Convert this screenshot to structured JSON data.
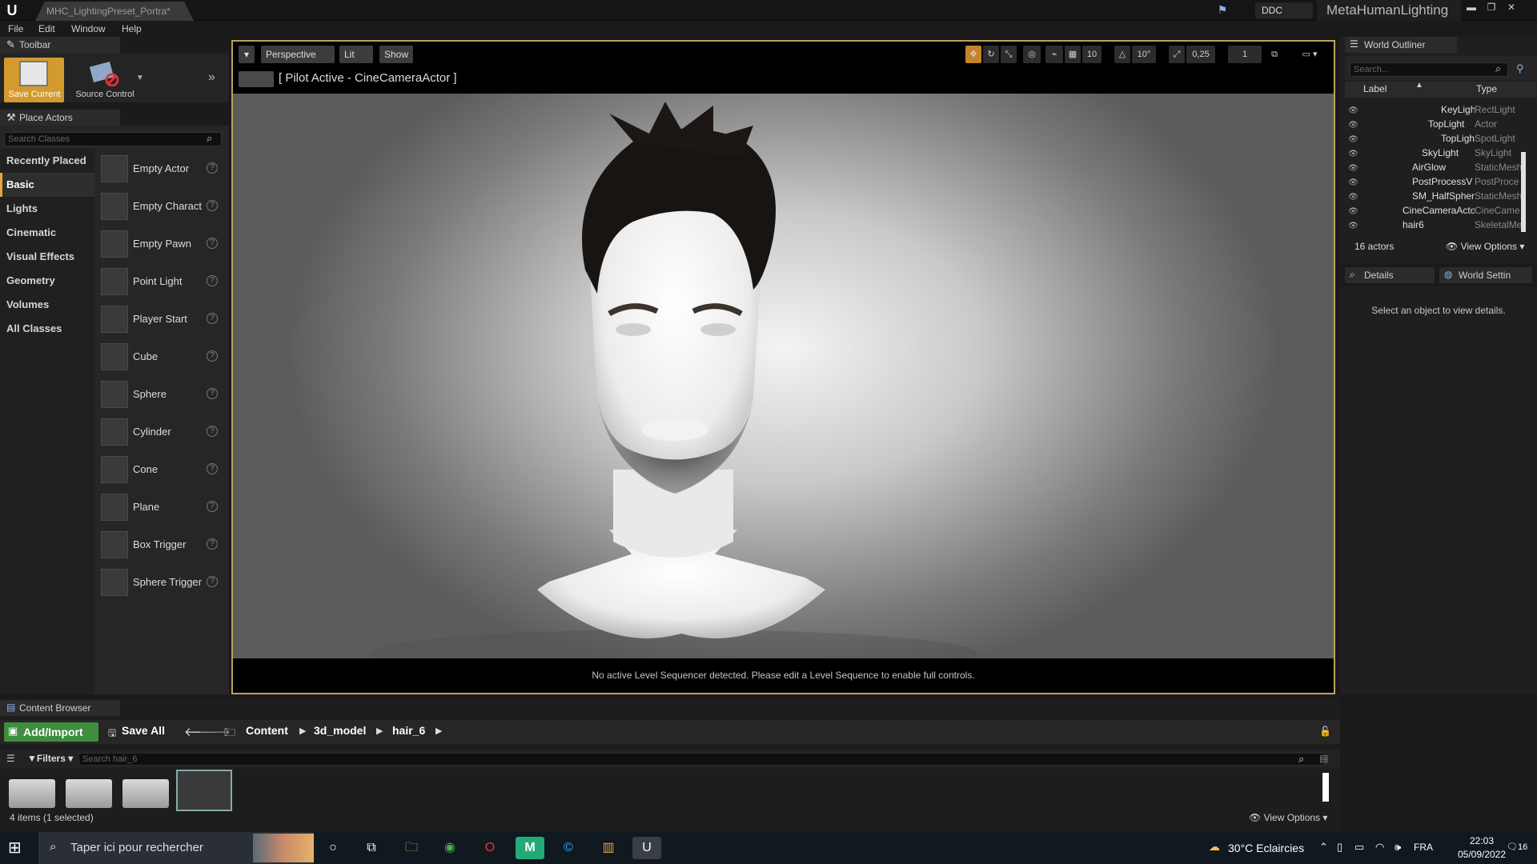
{
  "titlebar": {
    "logo": "U",
    "tab": "MHC_LightingPreset_Portra*",
    "ddc_label": "DDC",
    "project": "MetaHumanLighting",
    "win_min": "▬",
    "win_max": "❐",
    "win_close": "✕"
  },
  "menu": [
    "File",
    "Edit",
    "Window",
    "Help"
  ],
  "toolbar": {
    "tab": "Toolbar",
    "save_label": "Save Current",
    "source_label": "Source Control"
  },
  "place_actors": {
    "tab": "Place Actors",
    "search_placeholder": "Search Classes",
    "categories": [
      "Recently Placed",
      "Basic",
      "Lights",
      "Cinematic",
      "Visual Effects",
      "Geometry",
      "Volumes",
      "All Classes"
    ],
    "active_category": "Basic",
    "actors": [
      "Empty Actor",
      "Empty Charact",
      "Empty Pawn",
      "Point Light",
      "Player Start",
      "Cube",
      "Sphere",
      "Cylinder",
      "Cone",
      "Plane",
      "Box Trigger",
      "Sphere Trigger"
    ],
    "help": "?"
  },
  "viewport": {
    "perspective": "Perspective",
    "lit": "Lit",
    "show": "Show",
    "pilot": "[ Pilot Active - CineCameraActor ]",
    "snap_grid": "10",
    "snap_rot": "10°",
    "snap_scale": "0,25",
    "cam_speed": "1",
    "sequencer_msg": "No active Level Sequencer detected. Please edit a Level Sequence to enable full controls."
  },
  "outliner": {
    "tab": "World Outliner",
    "search_placeholder": "Search...",
    "col_label": "Label",
    "col_type": "Type",
    "rows": [
      {
        "label": "KeyLight",
        "type": "RectLight",
        "indent": 3
      },
      {
        "label": "TopLight",
        "type": "Actor",
        "indent": 2
      },
      {
        "label": "TopLight",
        "type": "SpotLight",
        "indent": 3
      },
      {
        "label": "SkyLight",
        "type": "SkyLight",
        "indent": 1
      },
      {
        "label": "AirGlow",
        "type": "StaticMesh",
        "indent": 0
      },
      {
        "label": "PostProcessV",
        "type": "PostProce",
        "indent": 0
      },
      {
        "label": "SM_HalfSpher",
        "type": "StaticMesh",
        "indent": 0
      },
      {
        "label": "CineCameraActo",
        "type": "CineCame",
        "indent": -1
      },
      {
        "label": "hair6",
        "type": "SkeletalMe",
        "indent": -1
      }
    ],
    "count": "16 actors",
    "view_options": "View Options"
  },
  "details": {
    "tab": "Details",
    "world_settings_tab": "World Settin",
    "empty_msg": "Select an object to view details."
  },
  "content_browser": {
    "tab": "Content Browser",
    "add_import": "Add/Import",
    "save_all": "Save All",
    "breadcrumb": [
      "Content",
      "3d_model",
      "hair_6"
    ],
    "filters": "Filters",
    "search_placeholder": "Search hair_6",
    "status": "4 items (1 selected)",
    "view_options": "View Options"
  },
  "taskbar": {
    "search_placeholder": "Taper ici pour rechercher",
    "weather": "30°C  Eclaircies",
    "lang": "FRA",
    "time": "22:03",
    "date": "05/09/2022",
    "notif_count": "16"
  },
  "colors": {
    "accent_orange": "#d39a2f",
    "add_green": "#3e8e3e",
    "viewport_border": "#bfa15a"
  }
}
